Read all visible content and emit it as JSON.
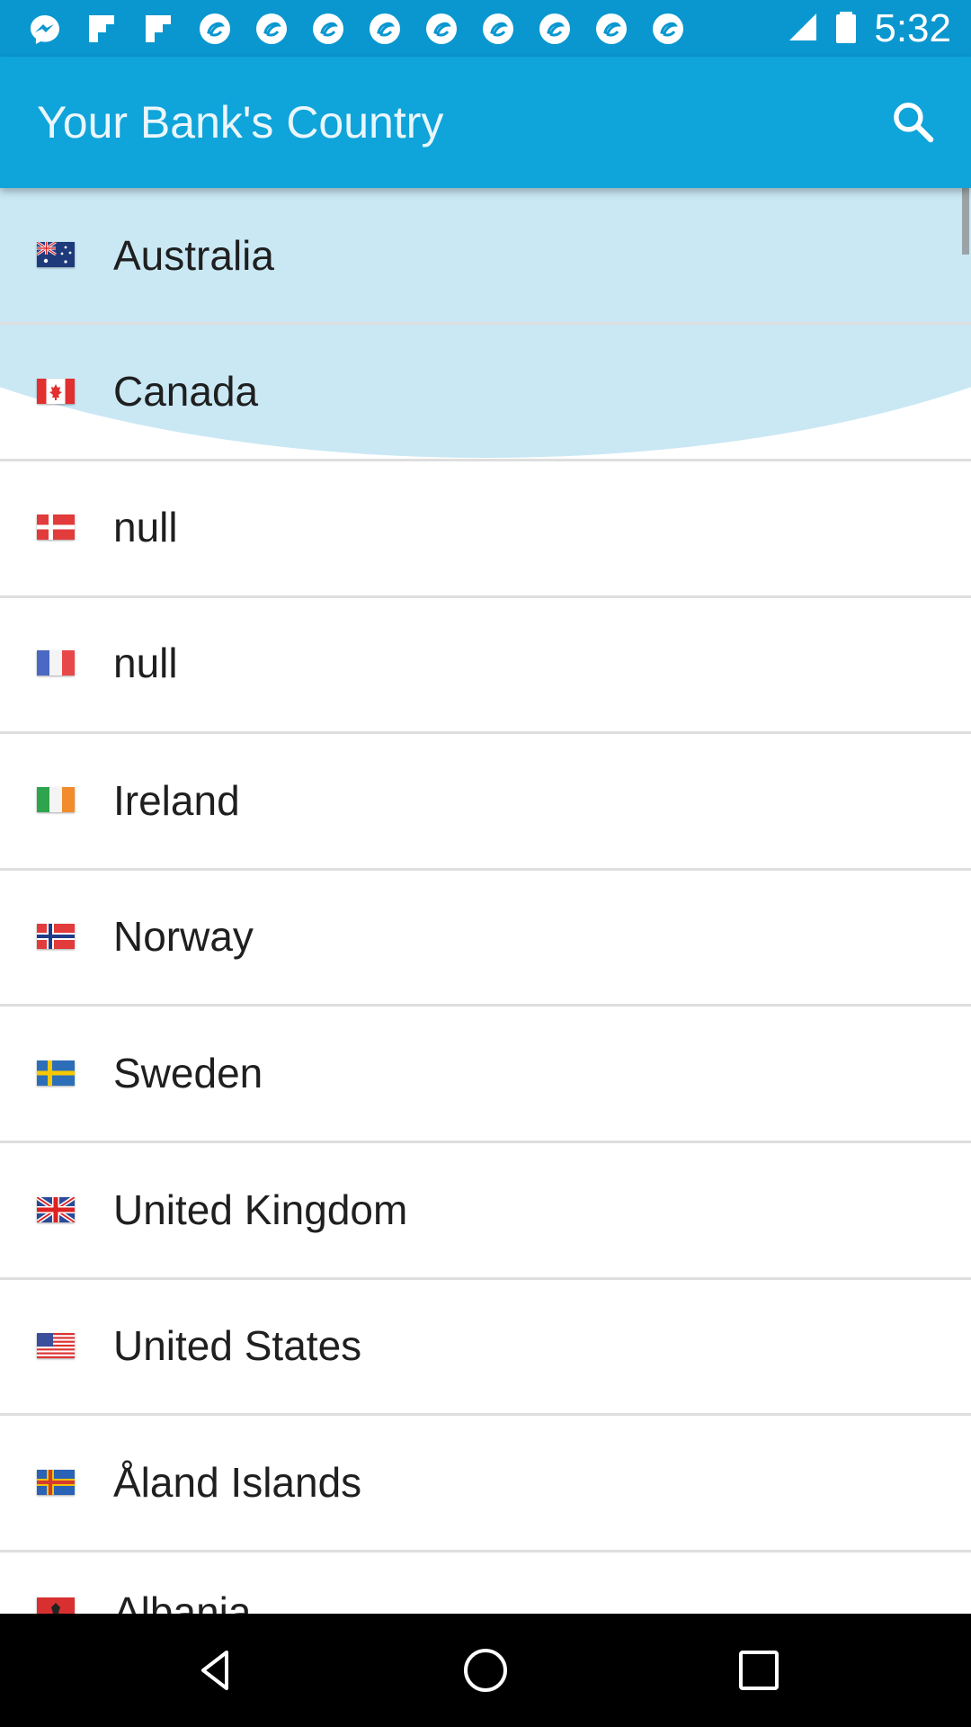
{
  "status_bar": {
    "time": "5:32",
    "icons": [
      "messenger-icon",
      "flipboard-icon",
      "flipboard-icon",
      "app-icon",
      "app-icon",
      "app-icon",
      "app-icon",
      "app-icon",
      "app-icon",
      "app-icon",
      "app-icon",
      "app-icon"
    ],
    "right_icons": [
      "signal-icon",
      "battery-icon"
    ]
  },
  "app_bar": {
    "title": "Your Bank's Country",
    "search_icon": "search-icon"
  },
  "countries": [
    {
      "name": "Australia",
      "flag": "australia"
    },
    {
      "name": "Canada",
      "flag": "canada"
    },
    {
      "name": "null",
      "flag": "denmark"
    },
    {
      "name": "null",
      "flag": "france"
    },
    {
      "name": "Ireland",
      "flag": "ireland"
    },
    {
      "name": "Norway",
      "flag": "norway"
    },
    {
      "name": "Sweden",
      "flag": "sweden"
    },
    {
      "name": "United Kingdom",
      "flag": "united-kingdom"
    },
    {
      "name": "United States",
      "flag": "united-states"
    },
    {
      "name": "Åland Islands",
      "flag": "aland-islands"
    },
    {
      "name": "Albania",
      "flag": "albania"
    }
  ],
  "nav_bar": {
    "back_icon": "back-icon",
    "home_icon": "home-icon",
    "recents_icon": "recents-icon"
  },
  "colors": {
    "status_bar": "#0a97cf",
    "app_bar": "#0fa4da",
    "ripple": "#c9e8f4",
    "divider": "#dedede"
  }
}
